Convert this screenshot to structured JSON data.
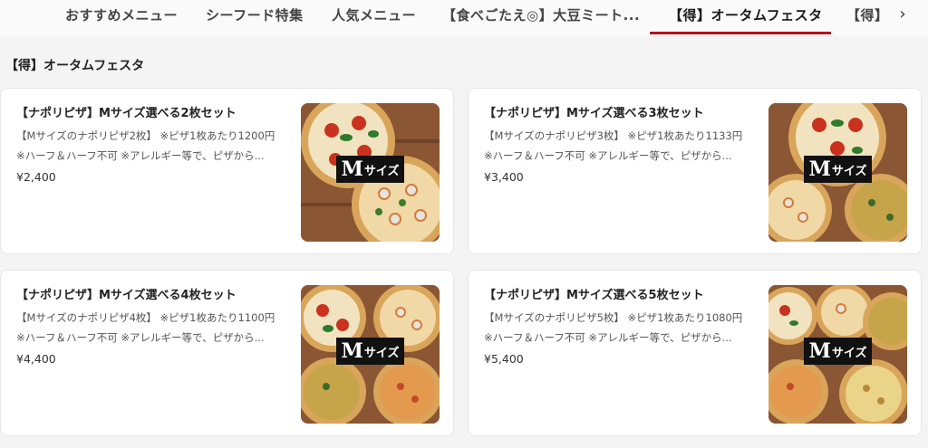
{
  "tabs": [
    {
      "label": "おすすめメニュー"
    },
    {
      "label": "シーフード特集"
    },
    {
      "label": "人気メニュー"
    },
    {
      "label": "【食べごたえ◎】大豆ミート..."
    },
    {
      "label": "【得】オータムフェスタ"
    },
    {
      "label": "【得】"
    }
  ],
  "active_tab": "【得】オータムフェスタ",
  "section": {
    "title": "【得】オータムフェスタ"
  },
  "badge_text": {
    "big": "M",
    "small": "サイズ"
  },
  "cards": [
    {
      "name": "【ナポリピザ】Mサイズ選べる2枚セット",
      "desc_line1": "【Mサイズのナポリピザ2枚】 ※ピザ1枚あたり1200円",
      "desc_line2": "※ハーフ＆ハーフ不可 ※アレルギー等で、ピザから...",
      "price": "¥2,400"
    },
    {
      "name": "【ナポリピザ】Mサイズ選べる3枚セット",
      "desc_line1": "【Mサイズのナポリピザ3枚】 ※ピザ1枚あたり1133円",
      "desc_line2": "※ハーフ＆ハーフ不可 ※アレルギー等で、ピザから...",
      "price": "¥3,400"
    },
    {
      "name": "【ナポリピザ】Mサイズ選べる4枚セット",
      "desc_line1": "【Mサイズのナポリピザ4枚】 ※ピザ1枚あたり1100円",
      "desc_line2": "※ハーフ＆ハーフ不可 ※アレルギー等で、ピザから...",
      "price": "¥4,400"
    },
    {
      "name": "【ナポリピザ】Mサイズ選べる5枚セット",
      "desc_line1": "【Mサイズのナポリピザ5枚】 ※ピザ1枚あたり1080円",
      "desc_line2": "※ハーフ＆ハーフ不可 ※アレルギー等で、ピザから...",
      "price": "¥5,400"
    }
  ],
  "icons": {
    "next": "chevron-right-icon"
  },
  "colors": {
    "accent": "#b3121b",
    "background": "#f4f4f4",
    "card": "#ffffff"
  }
}
